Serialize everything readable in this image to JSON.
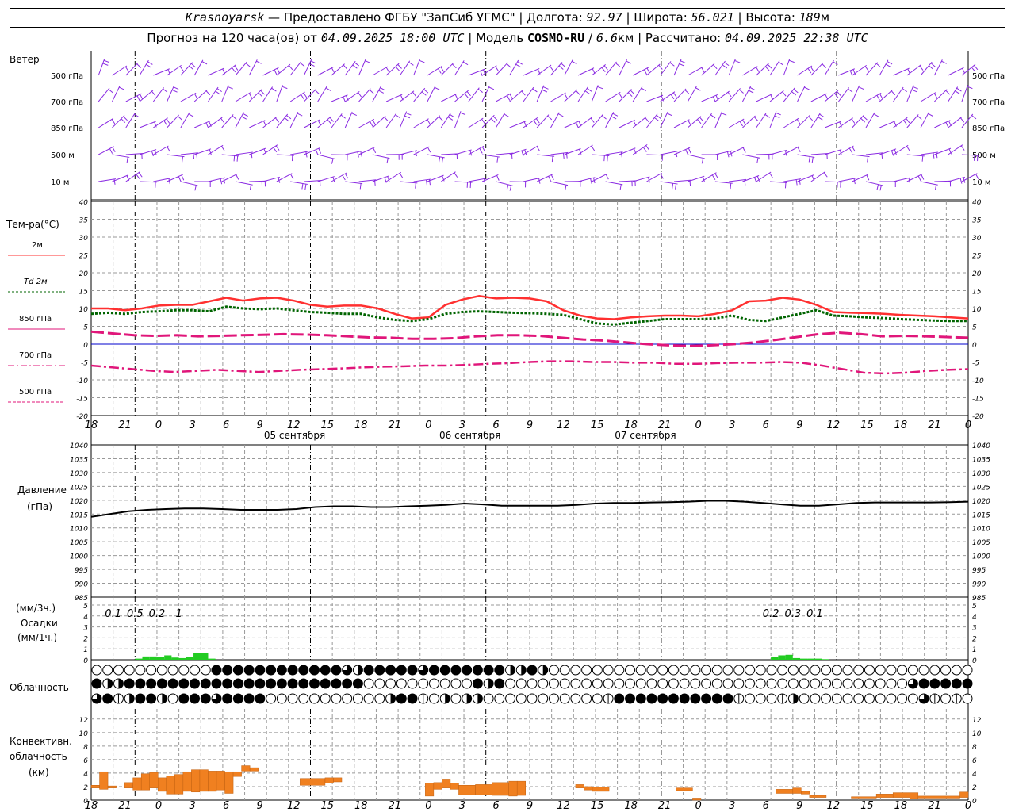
{
  "header": {
    "station": "Krasnoyarsk",
    "dash": "—",
    "provider": "Предоставлено ФГБУ \"ЗапСиб УГМС\"",
    "lon_label": "Долгота:",
    "lon": "92.97",
    "lat_label": "Широта:",
    "lat": "56.021",
    "alt_label": "Высота:",
    "alt": "189",
    "alt_unit": "м",
    "forecast_prefix": "Прогноз на 120 часа(ов) от",
    "forecast_from": "04.09.2025 18:00 UTC",
    "model_label": "Модель",
    "model": "COSMO-RU",
    "model_res": "6.6",
    "model_res_unit": "км",
    "computed_label": "Рассчитано:",
    "computed": "04.09.2025 22:38 UTC"
  },
  "wind_panel": {
    "title": "Ветер",
    "levels": [
      "500 гПа",
      "700 гПа",
      "850 гПа",
      "500 м",
      "10 м"
    ],
    "color": "#8a2be2"
  },
  "temp_panel": {
    "title": "Тем-ра(°C)",
    "legend": [
      "2м",
      "Td 2м",
      "850 гПа",
      "700 гПа",
      "500 гПа"
    ],
    "yticks": [
      40,
      35,
      30,
      25,
      20,
      15,
      10,
      5,
      0,
      -5,
      -10,
      -15,
      -20
    ]
  },
  "x_axis": {
    "hour_labels": [
      "18",
      "21",
      "0",
      "3",
      "6",
      "9",
      "12",
      "15",
      "18",
      "21",
      "0",
      "3",
      "6",
      "9",
      "12",
      "15",
      "18",
      "21",
      "0",
      "3",
      "6",
      "9",
      "12",
      "15",
      "18",
      "21",
      "0"
    ],
    "day_labels": [
      "05 сентября",
      "06 сентября",
      "07 сентября"
    ]
  },
  "pressure_panel": {
    "title": "Давление",
    "unit": "(гПа)",
    "yticks": [
      1040,
      1035,
      1030,
      1025,
      1020,
      1015,
      1010,
      1005,
      1000,
      995,
      990,
      985
    ]
  },
  "precip_panel": {
    "unit1": "(мм/3ч.)",
    "title": "Осадки",
    "unit2": "(мм/1ч.)",
    "yticks": [
      5,
      4,
      3,
      2,
      1,
      0
    ],
    "annotations": [
      {
        "hour": 3,
        "text": "0.1"
      },
      {
        "hour": 6,
        "text": "0.5"
      },
      {
        "hour": 9,
        "text": "0.2"
      },
      {
        "hour": 12,
        "text": "1"
      },
      {
        "hour": 93,
        "text": "0.2"
      },
      {
        "hour": 96,
        "text": "0.3"
      },
      {
        "hour": 99,
        "text": "0.1"
      }
    ]
  },
  "cloud_panel": {
    "title": "Облачность"
  },
  "conv_panel": {
    "title1": "Конвективн.",
    "title2": "облачность",
    "unit": "(км)",
    "yticks": [
      12,
      10,
      8,
      6,
      4,
      2,
      0
    ]
  },
  "colors": {
    "t2m": "#ff3030",
    "td2m": "#006400",
    "t850": "#e0167a",
    "t700": "#e0167a",
    "t500": "#e0167a",
    "zero_line": "#0000cc",
    "pressure": "#000000",
    "precip": "#22cc22",
    "convective": "#f08020"
  },
  "chart_data": {
    "type": "line",
    "x_unit": "hours since 04.09.2025 18:00 UTC",
    "x": [
      0,
      3,
      6,
      9,
      12,
      15,
      18,
      21,
      24,
      27,
      30,
      33,
      36,
      39,
      42,
      45,
      48,
      51,
      54,
      57,
      60,
      63,
      66,
      69,
      72,
      75,
      78,
      81,
      84,
      87,
      90,
      93,
      96,
      99,
      102,
      105,
      108,
      111,
      114,
      117,
      120
    ],
    "series": [
      {
        "name": "2м",
        "values": [
          10,
          10,
          9.5,
          10,
          10.8,
          11,
          11,
          12,
          13,
          12.2,
          12.8,
          13,
          12.2,
          11,
          10.5,
          10.8,
          10.8,
          10,
          8.5,
          7.2,
          7.5,
          11,
          12.5,
          13.5,
          12.8,
          13,
          12.8,
          12,
          9.5,
          8,
          7.2,
          7,
          7.5,
          7.8,
          8,
          8,
          7.8,
          8.5,
          9.5,
          12,
          12.2,
          13,
          12.5,
          11,
          9,
          8.8,
          8.7,
          8.5,
          8.2,
          8,
          7.8,
          7.5,
          7.2
        ]
      },
      {
        "name": "Td 2м",
        "values": [
          8.5,
          8.8,
          8.5,
          9,
          9.2,
          9.5,
          9.5,
          9.2,
          10.5,
          10,
          9.8,
          10,
          9.5,
          9,
          8.8,
          8.5,
          8.5,
          7.5,
          6.8,
          6.5,
          7,
          8.5,
          9,
          9.2,
          9,
          8.8,
          8.7,
          8.5,
          8.2,
          7,
          5.8,
          5.5,
          6,
          6.5,
          7,
          7,
          7,
          7.2,
          8,
          6.8,
          6.5,
          7.5,
          8.5,
          9.5,
          8,
          7.8,
          7.5,
          7.3,
          7,
          6.8,
          6.6,
          6.5,
          6.5
        ]
      },
      {
        "name": "850 гПа",
        "values": [
          3.5,
          3,
          2.5,
          2.3,
          2.5,
          2.2,
          2.3,
          2.5,
          2.6,
          2.8,
          2.7,
          2.5,
          2.2,
          1.9,
          1.8,
          1.5,
          1.5,
          1.7,
          2.2,
          2.5,
          2.5,
          2.3,
          1.8,
          1.3,
          1,
          0.5,
          0,
          -0.3,
          -0.5,
          -0.3,
          0,
          0.5,
          1.2,
          2,
          2.8,
          3.2,
          2.8,
          2.2,
          2.3,
          2.2,
          2,
          1.8
        ]
      },
      {
        "name": "700 гПа",
        "values": [
          -6,
          -6.5,
          -7,
          -7.5,
          -7.8,
          -7.5,
          -7.2,
          -7.5,
          -7.8,
          -7.5,
          -7.2,
          -7,
          -6.8,
          -6.5,
          -6.3,
          -6.2,
          -6,
          -6,
          -5.8,
          -5.5,
          -5.3,
          -5,
          -4.8,
          -4.8,
          -5,
          -5,
          -5.2,
          -5.2,
          -5.5,
          -5.5,
          -5.3,
          -5.2,
          -5.2,
          -5,
          -5.2,
          -6,
          -7,
          -8,
          -8.2,
          -8,
          -7.5,
          -7.2,
          -7
        ]
      },
      {
        "name": "Давление",
        "values": [
          1014,
          1015,
          1016,
          1016.5,
          1016.8,
          1017,
          1017,
          1016.8,
          1016.5,
          1016.5,
          1016.5,
          1016.8,
          1017.5,
          1017.8,
          1017.8,
          1017.5,
          1017.5,
          1017.8,
          1018,
          1018.3,
          1018.8,
          1018.5,
          1018,
          1018,
          1018,
          1018,
          1018.3,
          1018.8,
          1019,
          1019,
          1019.2,
          1019.3,
          1019.5,
          1019.8,
          1019.8,
          1019.5,
          1019,
          1018.5,
          1018,
          1018,
          1018.5,
          1019,
          1019.2,
          1019.2,
          1019.2,
          1019.2,
          1019.3,
          1019.5
        ]
      },
      {
        "name": "Осадки мм/1ч",
        "hours": [
          6,
          7,
          8,
          9,
          10,
          11,
          12,
          13,
          14,
          15,
          16,
          93,
          94,
          95,
          96,
          97,
          98,
          99,
          100
        ],
        "values": [
          0.1,
          0.3,
          0.3,
          0.25,
          0.4,
          0.2,
          0.15,
          0.25,
          0.6,
          0.6,
          0.1,
          0.25,
          0.4,
          0.45,
          0.15,
          0.1,
          0.1,
          0.1,
          0.05
        ]
      }
    ],
    "convective": [
      {
        "h0": 0,
        "h1": 1,
        "base": 1.8,
        "top": 2.2
      },
      {
        "h0": 1,
        "h1": 2,
        "base": 1.6,
        "top": 4.2
      },
      {
        "h0": 2,
        "h1": 3,
        "base": 1.8,
        "top": 2.1
      },
      {
        "h0": 4,
        "h1": 5,
        "base": 1.8,
        "top": 2.6
      },
      {
        "h0": 5,
        "h1": 6,
        "base": 1.5,
        "top": 3.3
      },
      {
        "h0": 6,
        "h1": 7,
        "base": 1.5,
        "top": 3.9
      },
      {
        "h0": 7,
        "h1": 8,
        "base": 1.8,
        "top": 4.1
      },
      {
        "h0": 8,
        "h1": 9,
        "base": 1.3,
        "top": 3.3
      },
      {
        "h0": 9,
        "h1": 10,
        "base": 0.9,
        "top": 3.6
      },
      {
        "h0": 10,
        "h1": 11,
        "base": 0.9,
        "top": 3.8
      },
      {
        "h0": 11,
        "h1": 12,
        "base": 1.3,
        "top": 4.2
      },
      {
        "h0": 12,
        "h1": 13,
        "base": 1.2,
        "top": 4.5
      },
      {
        "h0": 13,
        "h1": 14,
        "base": 1.3,
        "top": 4.5
      },
      {
        "h0": 14,
        "h1": 15,
        "base": 1.3,
        "top": 4.3
      },
      {
        "h0": 15,
        "h1": 16,
        "base": 1.5,
        "top": 4.3
      },
      {
        "h0": 16,
        "h1": 17,
        "base": 1,
        "top": 4.2
      },
      {
        "h0": 17,
        "h1": 18,
        "base": 3.5,
        "top": 4.2
      },
      {
        "h0": 18,
        "h1": 19,
        "base": 4.3,
        "top": 5.1
      },
      {
        "h0": 19,
        "h1": 20,
        "base": 4.3,
        "top": 4.8
      },
      {
        "h0": 25,
        "h1": 28,
        "base": 2.2,
        "top": 3.2
      },
      {
        "h0": 28,
        "h1": 29,
        "base": 2.5,
        "top": 3.3
      },
      {
        "h0": 29,
        "h1": 30,
        "base": 2.7,
        "top": 3.3
      },
      {
        "h0": 40,
        "h1": 41,
        "base": 0.6,
        "top": 2.5
      },
      {
        "h0": 41,
        "h1": 42,
        "base": 1.6,
        "top": 2.6
      },
      {
        "h0": 42,
        "h1": 43,
        "base": 1.8,
        "top": 3.0
      },
      {
        "h0": 43,
        "h1": 44,
        "base": 1.6,
        "top": 2.5
      },
      {
        "h0": 44,
        "h1": 46,
        "base": 0.8,
        "top": 2.2
      },
      {
        "h0": 46,
        "h1": 48,
        "base": 0.8,
        "top": 2.3
      },
      {
        "h0": 48,
        "h1": 50,
        "base": 0.7,
        "top": 2.6
      },
      {
        "h0": 50,
        "h1": 51,
        "base": 0.6,
        "top": 2.8
      },
      {
        "h0": 51,
        "h1": 52,
        "base": 0.7,
        "top": 2.8
      },
      {
        "h0": 58,
        "h1": 59,
        "base": 1.8,
        "top": 2.3
      },
      {
        "h0": 59,
        "h1": 60,
        "base": 1.5,
        "top": 2.0
      },
      {
        "h0": 60,
        "h1": 62,
        "base": 1.3,
        "top": 1.9
      },
      {
        "h0": 70,
        "h1": 72,
        "base": 1.4,
        "top": 1.8
      },
      {
        "h0": 72,
        "h1": 73,
        "base": 0,
        "top": 0.3
      },
      {
        "h0": 82,
        "h1": 84,
        "base": 1.0,
        "top": 1.6
      },
      {
        "h0": 84,
        "h1": 85,
        "base": 1.0,
        "top": 1.8
      },
      {
        "h0": 85,
        "h1": 86,
        "base": 0.9,
        "top": 1.3
      },
      {
        "h0": 86,
        "h1": 88,
        "base": 0.4,
        "top": 0.7
      },
      {
        "h0": 91,
        "h1": 94,
        "base": 0.3,
        "top": 0.5
      },
      {
        "h0": 94,
        "h1": 96,
        "base": 0.4,
        "top": 0.9
      },
      {
        "h0": 96,
        "h1": 98,
        "base": 0.4,
        "top": 1.1
      },
      {
        "h0": 98,
        "h1": 99,
        "base": 0.2,
        "top": 1.1
      },
      {
        "h0": 99,
        "h1": 104,
        "base": 0.3,
        "top": 0.6
      },
      {
        "h0": 104,
        "h1": 105,
        "base": 0.4,
        "top": 1.2
      }
    ],
    "clouds": {
      "rows": [
        "00000000000444444444444324444434444444224200000000000000000000000000000000000000000000002000001020210202000001120000000",
        "4224444444444444444444444000000000042400000000000000000000000000000000000003444444444444444444244444444444444444414444",
        "34124420444344440000000000024410202200000000000144444444444100012000000000003101000000000000002144444444444444444444444"
      ]
    },
    "wind": {
      "rows": 5,
      "count": 64
    }
  }
}
